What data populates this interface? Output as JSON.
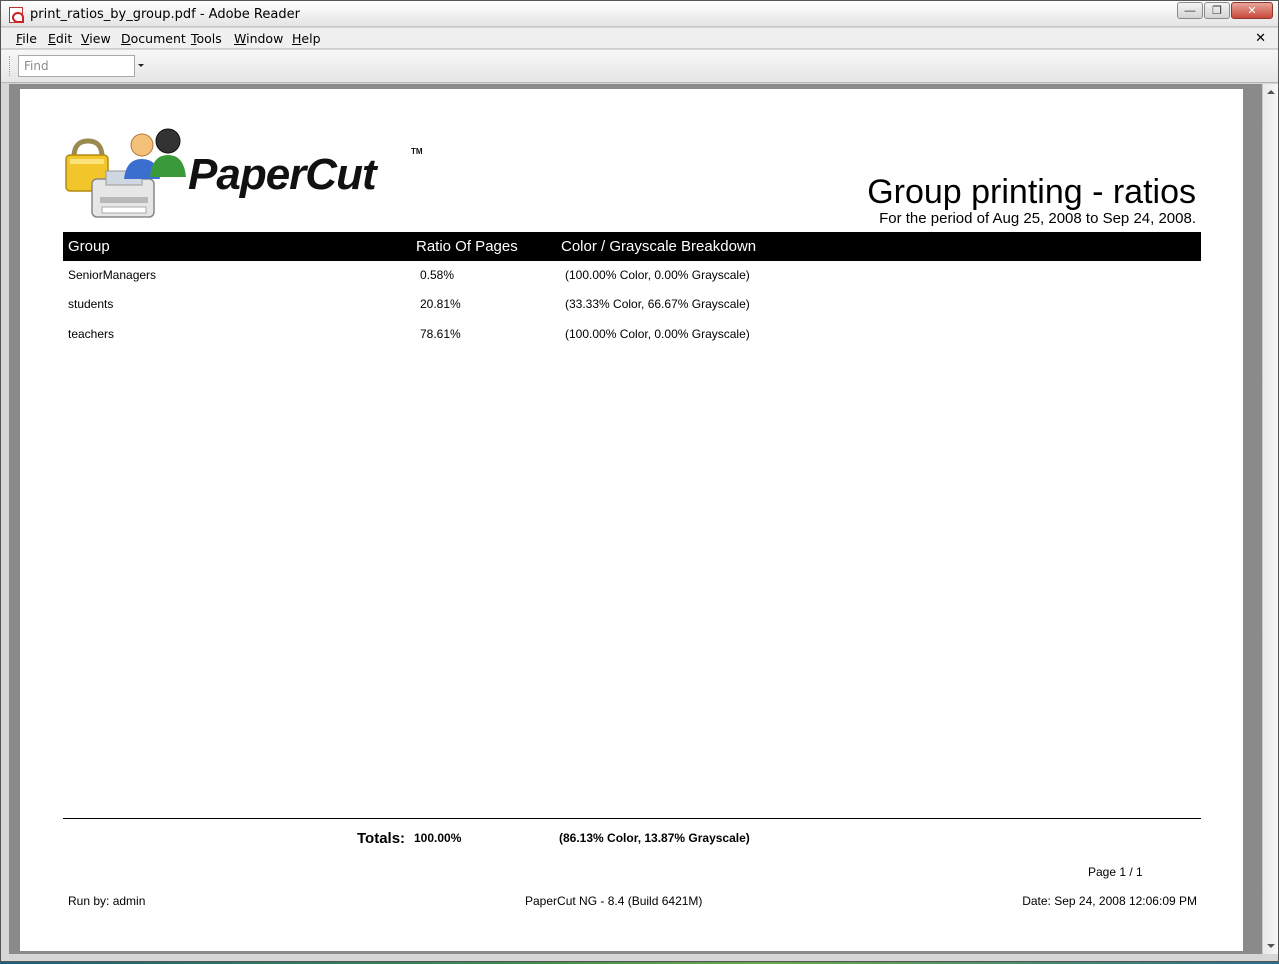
{
  "window": {
    "title": "print_ratios_by_group.pdf - Adobe Reader",
    "minimize_glyph": "—",
    "maximize_glyph": "❐",
    "close_glyph": "✕"
  },
  "menu": {
    "items": [
      {
        "accel": "F",
        "rest": "ile"
      },
      {
        "accel": "E",
        "rest": "dit"
      },
      {
        "accel": "V",
        "rest": "iew"
      },
      {
        "accel": "D",
        "rest": "ocument"
      },
      {
        "accel": "T",
        "rest": "ools"
      },
      {
        "accel": "W",
        "rest": "indow"
      },
      {
        "accel": "H",
        "rest": "elp"
      }
    ],
    "close_glyph": "✕"
  },
  "toolbar": {
    "find_placeholder": "Find"
  },
  "report": {
    "logo_text": "PaperCut",
    "logo_tm": "TM",
    "title": "Group printing - ratios",
    "period": "For the period of Aug 25, 2008 to Sep 24, 2008.",
    "columns": [
      "Group",
      "Ratio Of Pages",
      "Color / Grayscale Breakdown"
    ],
    "rows": [
      {
        "group": "SeniorManagers",
        "ratio": "0.58%",
        "breakdown": "(100.00% Color, 0.00% Grayscale)"
      },
      {
        "group": "students",
        "ratio": "20.81%",
        "breakdown": "(33.33% Color, 66.67% Grayscale)"
      },
      {
        "group": "teachers",
        "ratio": "78.61%",
        "breakdown": "(100.00% Color, 0.00% Grayscale)"
      }
    ],
    "totals_label": "Totals:",
    "totals_ratio": "100.00%",
    "totals_breakdown": "(86.13% Color, 13.87% Grayscale)",
    "page_number": "Page 1 / 1",
    "run_by": "Run by: admin",
    "product": "PaperCut NG - 8.4 (Build 6421M)",
    "date": "Date: Sep 24, 2008 12:06:09 PM"
  },
  "icons": [
    "pdf-file-icon",
    "lock-icon",
    "printer-icon",
    "users-icon",
    "dropdown-arrow-icon"
  ]
}
